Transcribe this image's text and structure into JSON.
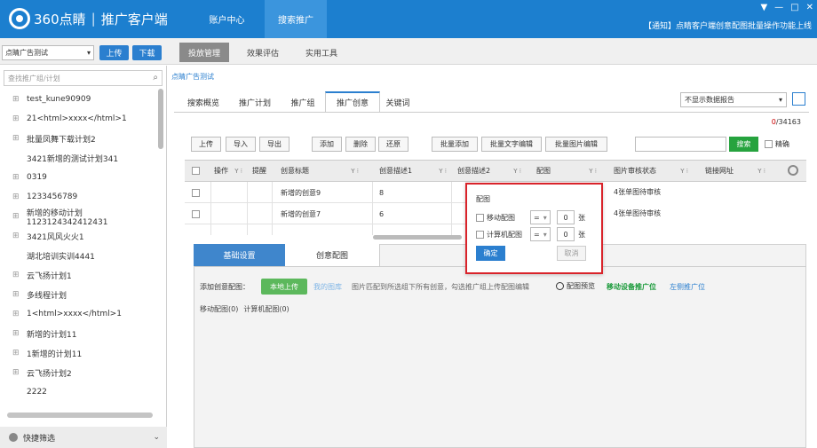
{
  "app": {
    "logo": "360点睛",
    "product": "推广客户端"
  },
  "nav": {
    "account_center": "账户中心",
    "search_promo": "搜索推广"
  },
  "notice": "【通知】点睛客户端创意配图批量操作功能上线",
  "window_controls": [
    "▼",
    "—",
    "□",
    "✕"
  ],
  "account_select": {
    "value": "点睛广告测试",
    "arrow": "▾"
  },
  "buttons": {
    "upload": "上传",
    "download": "下载"
  },
  "subtabs": [
    "投放管理",
    "效果评估",
    "实用工具"
  ],
  "sidebar": {
    "search_placeholder": "查找推广组/计划",
    "items": [
      {
        "toggle": "⊞",
        "label": "test_kune90909"
      },
      {
        "toggle": "⊞",
        "label": "21<html>xxxx</html>1"
      },
      {
        "toggle": "⊞",
        "label": "批量凤舞下载计划2"
      },
      {
        "toggle": "",
        "label": "3421新增的测试计划341"
      },
      {
        "toggle": "⊞",
        "label": "0319"
      },
      {
        "toggle": "⊞",
        "label": "1233456789"
      },
      {
        "toggle": "⊞",
        "label": "新增的移动计划1123124342412431"
      },
      {
        "toggle": "⊞",
        "label": "3421风风火火1"
      },
      {
        "toggle": "",
        "label": "湖北培训实训4441"
      },
      {
        "toggle": "⊞",
        "label": "云飞扬计划1"
      },
      {
        "toggle": "⊞",
        "label": "多线程计划"
      },
      {
        "toggle": "⊞",
        "label": "1<html>xxxx</html>1"
      },
      {
        "toggle": "⊞",
        "label": "新增的计划11"
      },
      {
        "toggle": "⊞",
        "label": "1新增的计划11"
      },
      {
        "toggle": "⊞",
        "label": "云飞扬计划2"
      },
      {
        "toggle": "",
        "label": "2222"
      }
    ],
    "quick_filter": "快捷筛选",
    "quick_arrow": "⌄"
  },
  "breadcrumb": "点睛广告测试",
  "main_tabs": [
    "搜索概览",
    "推广计划",
    "推广组",
    "推广创意",
    "关键词"
  ],
  "report_select": {
    "value": "不显示数据报告",
    "arrow": "▾"
  },
  "count": {
    "selected": "0",
    "total": "/34163"
  },
  "toolbar": [
    "上传",
    "导入",
    "导出",
    "添加",
    "删除",
    "还原",
    "批量添加",
    "批量文字编辑",
    "批量图片编辑"
  ],
  "search_button": "搜索",
  "exact_label": "精确",
  "table": {
    "headers": [
      "操作",
      "提醒",
      "创意标题",
      "创意描述1",
      "创意描述2",
      "配图",
      "图片审核状态",
      "链接网址"
    ],
    "filter_glyph": "Y ⁝",
    "rows": [
      {
        "title": "新增的创意9",
        "desc1": "8",
        "status": "4张单图待审核"
      },
      {
        "title": "新增的创意7",
        "desc1": "6",
        "status": "4张单图待审核"
      }
    ]
  },
  "lower": {
    "tabs": [
      "基础设置",
      "创意配图"
    ],
    "add_label": "添加创意配图：",
    "local_upload": "本地上传",
    "my_library": "我的图库",
    "hint": "图片匹配到所选组下所有创意，勾选推广组上传配图编辑",
    "preview": "配图预览",
    "mobile_pos": "移动设备推广位",
    "left_pos": "左侧推广位",
    "mobile_count": "移动配图(0)",
    "pc_count": "计算机配图(0)"
  },
  "popup": {
    "title": "配图",
    "rows": [
      {
        "label": "移动配图",
        "op": "=",
        "value": "0",
        "unit": "张"
      },
      {
        "label": "计算机配图",
        "op": "=",
        "value": "0",
        "unit": "张"
      }
    ],
    "op_arrow": "▾",
    "ok": "确定",
    "cancel": "取消"
  },
  "colors": {
    "brand_blue": "#1c7fcf",
    "green": "#26a33e",
    "popup_border": "#d9232a"
  }
}
